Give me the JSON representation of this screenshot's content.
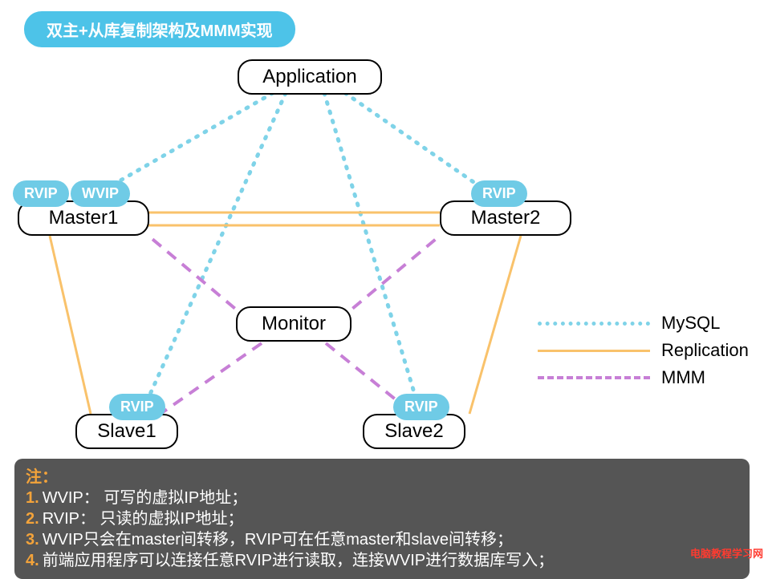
{
  "title": "双主+从库复制架构及MMM实现",
  "nodes": {
    "application": "Application",
    "master1": "Master1",
    "master2": "Master2",
    "monitor": "Monitor",
    "slave1": "Slave1",
    "slave2": "Slave2"
  },
  "vips": {
    "rvip": "RVIP",
    "wvip": "WVIP"
  },
  "legend": {
    "mysql": "MySQL",
    "replication": "Replication",
    "mmm": "MMM"
  },
  "notes": {
    "heading": "注：",
    "items": [
      "WVIP： 可写的虚拟IP地址；",
      "RVIP： 只读的虚拟IP地址；",
      "WVIP只会在master间转移，RVIP可在任意master和slave间转移；",
      "前端应用程序可以连接任意RVIP进行读取，连接WVIP进行数据库写入；"
    ]
  },
  "watermark": "电脑教程学习网",
  "chart_data": {
    "type": "diagram",
    "title": "双主+从库复制架构及MMM实现",
    "nodes": [
      {
        "id": "application",
        "label": "Application"
      },
      {
        "id": "master1",
        "label": "Master1",
        "vips": [
          "RVIP",
          "WVIP"
        ]
      },
      {
        "id": "master2",
        "label": "Master2",
        "vips": [
          "RVIP"
        ]
      },
      {
        "id": "monitor",
        "label": "Monitor"
      },
      {
        "id": "slave1",
        "label": "Slave1",
        "vips": [
          "RVIP"
        ]
      },
      {
        "id": "slave2",
        "label": "Slave2",
        "vips": [
          "RVIP"
        ]
      }
    ],
    "edges": [
      {
        "from": "application",
        "to": "master1",
        "type": "MySQL"
      },
      {
        "from": "application",
        "to": "master2",
        "type": "MySQL"
      },
      {
        "from": "application",
        "to": "slave1",
        "type": "MySQL"
      },
      {
        "from": "application",
        "to": "slave2",
        "type": "MySQL"
      },
      {
        "from": "master1",
        "to": "master2",
        "type": "Replication",
        "bidirectional": true
      },
      {
        "from": "master1",
        "to": "slave1",
        "type": "Replication"
      },
      {
        "from": "master2",
        "to": "slave2",
        "type": "Replication"
      },
      {
        "from": "monitor",
        "to": "master1",
        "type": "MMM"
      },
      {
        "from": "monitor",
        "to": "master2",
        "type": "MMM"
      },
      {
        "from": "monitor",
        "to": "slave1",
        "type": "MMM"
      },
      {
        "from": "monitor",
        "to": "slave2",
        "type": "MMM"
      }
    ],
    "legend": [
      {
        "label": "MySQL",
        "style": "dotted",
        "color": "#7fd3e8"
      },
      {
        "label": "Replication",
        "style": "solid",
        "color": "#f9c26b"
      },
      {
        "label": "MMM",
        "style": "dashed",
        "color": "#c77fd6"
      }
    ]
  }
}
